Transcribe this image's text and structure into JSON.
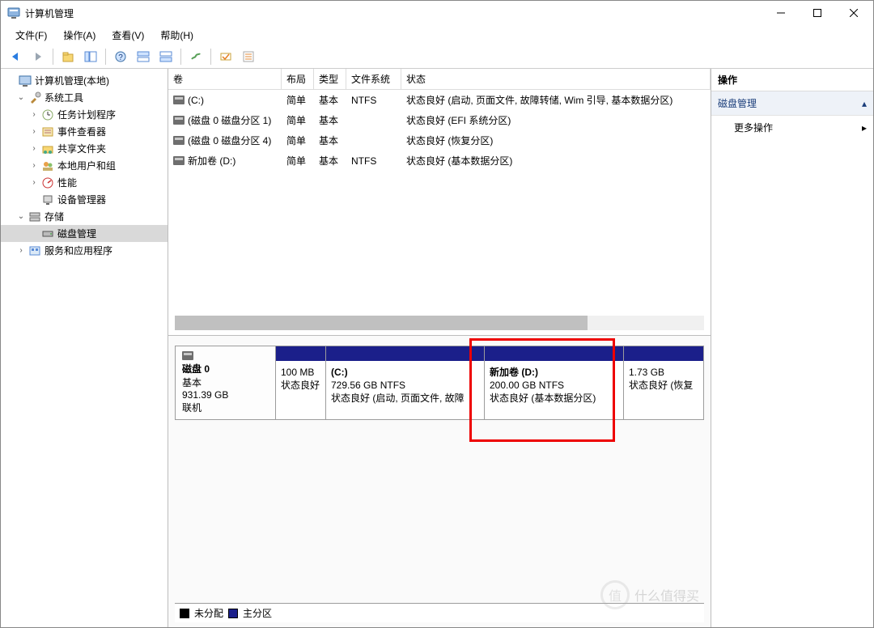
{
  "window": {
    "title": "计算机管理"
  },
  "menu": {
    "file": "文件(F)",
    "action": "操作(A)",
    "view": "查看(V)",
    "help": "帮助(H)"
  },
  "tree": {
    "root": "计算机管理(本地)",
    "systools": "系统工具",
    "sched": "任务计划程序",
    "event": "事件查看器",
    "shared": "共享文件夹",
    "users": "本地用户和组",
    "perf": "性能",
    "devmgr": "设备管理器",
    "storage": "存储",
    "diskmgmt": "磁盘管理",
    "services": "服务和应用程序"
  },
  "columns": {
    "volume": "卷",
    "layout": "布局",
    "type": "类型",
    "fs": "文件系统",
    "status": "状态"
  },
  "volumes": [
    {
      "name": "(C:)",
      "layout": "简单",
      "type": "基本",
      "fs": "NTFS",
      "status": "状态良好 (启动, 页面文件, 故障转储, Wim 引导, 基本数据分区)"
    },
    {
      "name": "(磁盘 0 磁盘分区 1)",
      "layout": "简单",
      "type": "基本",
      "fs": "",
      "status": "状态良好 (EFI 系统分区)"
    },
    {
      "name": "(磁盘 0 磁盘分区 4)",
      "layout": "简单",
      "type": "基本",
      "fs": "",
      "status": "状态良好 (恢复分区)"
    },
    {
      "name": "新加卷 (D:)",
      "layout": "简单",
      "type": "基本",
      "fs": "NTFS",
      "status": "状态良好 (基本数据分区)"
    }
  ],
  "disk": {
    "label": "磁盘 0",
    "type": "基本",
    "size": "931.39 GB",
    "state": "联机",
    "parts": [
      {
        "name": "",
        "info": "100 MB",
        "status": "状态良好"
      },
      {
        "name": "(C:)",
        "info": "729.56 GB NTFS",
        "status": "状态良好 (启动, 页面文件, 故障"
      },
      {
        "name": "新加卷  (D:)",
        "info": "200.00 GB NTFS",
        "status": "状态良好 (基本数据分区)"
      },
      {
        "name": "",
        "info": "1.73 GB",
        "status": "状态良好 (恢复"
      }
    ]
  },
  "legend": {
    "unallocated": "未分配",
    "primary": "主分区"
  },
  "actions": {
    "header": "操作",
    "category": "磁盘管理",
    "more": "更多操作"
  },
  "watermark": {
    "badge": "值",
    "text": "什么值得买"
  }
}
